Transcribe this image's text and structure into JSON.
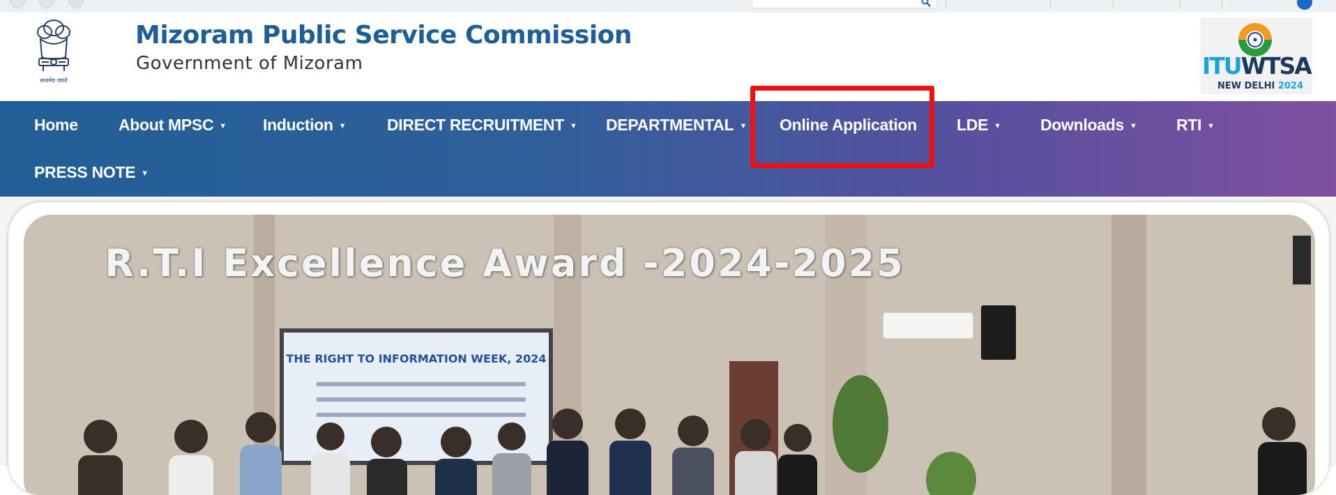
{
  "header": {
    "title": "Mizoram Public Service Commission",
    "subtitle": "Government of Mizoram",
    "emblem_caption": "सत्यमेव जयते"
  },
  "itu_logo": {
    "itu": "ITU",
    "wtsa": "WTSA",
    "city": "NEW DELHI",
    "year": "2024"
  },
  "nav": {
    "items": [
      {
        "label": "Home",
        "dropdown": false
      },
      {
        "label": "About MPSC",
        "dropdown": true
      },
      {
        "label": "Induction",
        "dropdown": true
      },
      {
        "label": "DIRECT RECRUITMENT",
        "dropdown": true
      },
      {
        "label": "DEPARTMENTAL",
        "dropdown": true
      },
      {
        "label": "Online Application",
        "dropdown": false,
        "highlighted": true
      },
      {
        "label": "LDE",
        "dropdown": true
      },
      {
        "label": "Downloads",
        "dropdown": true
      },
      {
        "label": "RTI",
        "dropdown": true
      },
      {
        "label": "PRESS NOTE",
        "dropdown": true
      }
    ],
    "caret": "▼"
  },
  "banner": {
    "caption": "R.T.I Excellence Award -2024-2025",
    "board_title": "THE RIGHT TO INFORMATION WEEK, 2024"
  },
  "colors": {
    "title_blue": "#1e5e98",
    "nav_start": "#215f96",
    "nav_end": "#7f519f",
    "highlight_red": "#ee1111"
  },
  "icons": [
    "search-icon",
    "accessibility-icon",
    "caret-down-icon",
    "national-emblem-icon"
  ]
}
